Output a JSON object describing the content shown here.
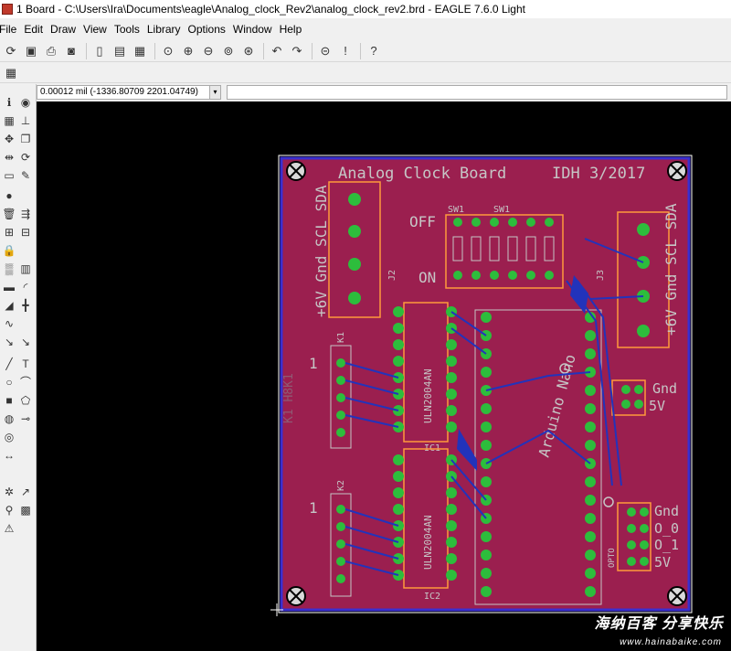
{
  "window": {
    "title": "1 Board - C:\\Users\\Ira\\Documents\\eagle\\Analog_clock_Rev2\\analog_clock_rev2.brd - EAGLE 7.6.0 Light"
  },
  "menu": [
    "File",
    "Edit",
    "Draw",
    "View",
    "Tools",
    "Library",
    "Options",
    "Window",
    "Help"
  ],
  "coords": {
    "value": "0.00012 mil (-1336.80709 2201.04749)"
  },
  "board": {
    "title": "Analog Clock Board",
    "rev": "IDH 3/2017",
    "labels": {
      "j2_pins": "+6V Gnd SCL SDA",
      "j3_pins": "+6V Gnd SCL SDA",
      "off": "OFF",
      "on": "ON",
      "sw1a": "SW1",
      "sw1b": "SW1",
      "j2": "J2",
      "j3": "J3",
      "k1": "K1",
      "k2": "K2",
      "k1_one": "1",
      "k2_one": "1",
      "ic1_part": "ULN2004AN",
      "ic2_part": "ULN2004AN",
      "ic1": "IC1",
      "ic2": "IC2",
      "nano": "Arduino Nano",
      "gnd_a": "Gnd",
      "five_a": "5V",
      "gnd_b": "Gnd",
      "o0": "O_0",
      "o1": "O_1",
      "five_b": "5V",
      "opto": "OPTO",
      "mirror": "K1 H8K1"
    },
    "colors": {
      "board": "#9b1f4f",
      "copper_top": "#b33a5e",
      "pad": "#2dbd3c",
      "silk": "#c6c6c6",
      "outline": "#ff9a3c",
      "bottom_trace": "#2233bb"
    }
  },
  "watermark": {
    "main": "海纳百客 分享快乐",
    "sub": "www.hainabaike.com"
  }
}
